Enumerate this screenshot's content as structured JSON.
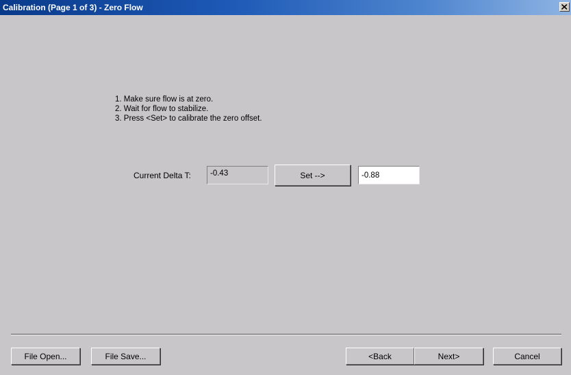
{
  "window": {
    "title": "Calibration (Page 1 of 3) - Zero Flow"
  },
  "instructions": [
    "1. Make sure flow is at zero.",
    "2. Wait for flow to stabilize.",
    "3. Press <Set> to calibrate the zero offset."
  ],
  "delta": {
    "label": "Current Delta T:",
    "current_value": "-0.43",
    "set_label": "Set -->",
    "offset_value": "-0.88"
  },
  "footer": {
    "file_open_label": "File Open...",
    "file_save_label": "File Save...",
    "back_label": "<Back",
    "next_label": "Next>",
    "cancel_label": "Cancel"
  },
  "icons": {
    "close": "close-icon"
  }
}
